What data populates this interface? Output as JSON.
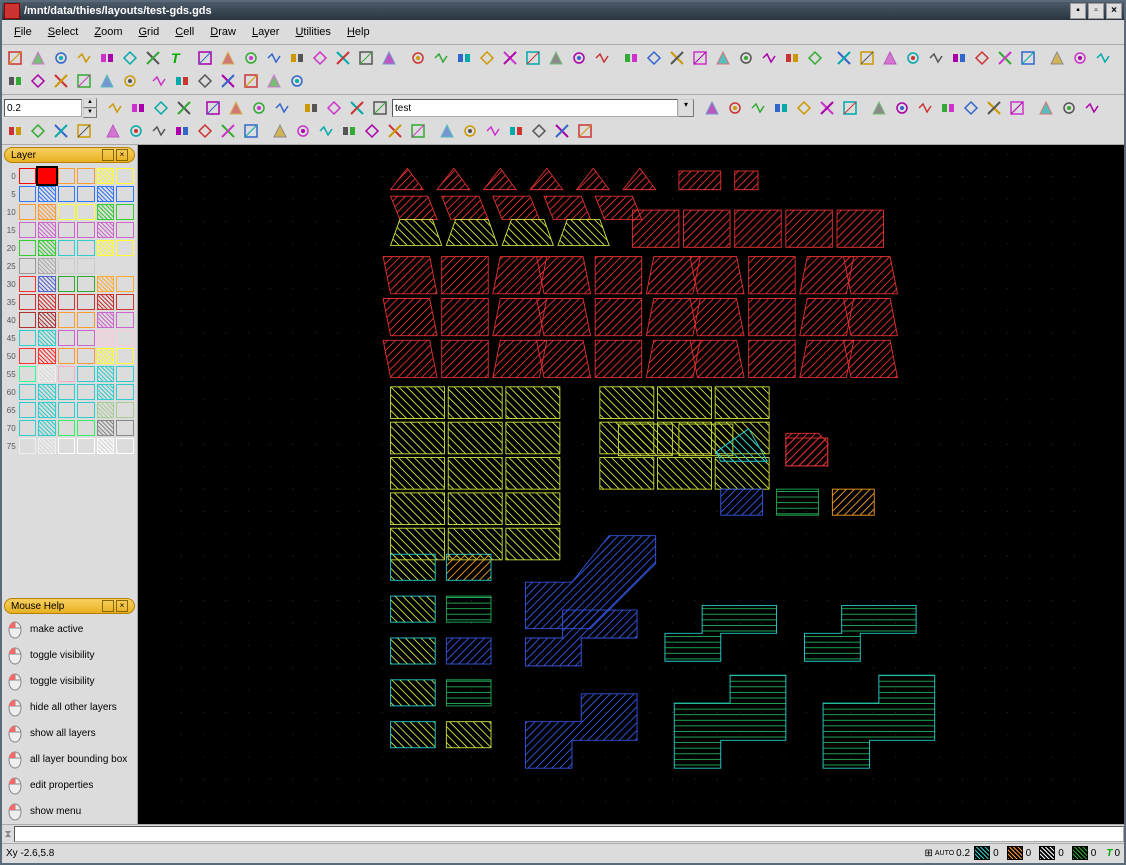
{
  "title": "/mnt/data/thies/layouts/test-gds.gds",
  "menus": [
    "File",
    "Select",
    "Zoom",
    "Grid",
    "Cell",
    "Draw",
    "Layer",
    "Utilities",
    "Help"
  ],
  "spin_value": "0.2",
  "cell_name": "test",
  "panel_layer_title": "Layer",
  "panel_mouse_title": "Mouse Help",
  "layer_rows": [
    {
      "n": "0",
      "c": [
        "#ff0000",
        "#ff0000",
        "#ff9933",
        "#ff9933",
        "#ffff33",
        "#ffff33"
      ]
    },
    {
      "n": "5",
      "c": [
        "#3377ff",
        "#3377ff",
        "#3377ff",
        "#3377ff",
        "#3377ff",
        "#3377ff"
      ]
    },
    {
      "n": "10",
      "c": [
        "#ff9933",
        "#ff9933",
        "#ffff33",
        "#ffff33",
        "#33cc33",
        "#33cc33"
      ]
    },
    {
      "n": "15",
      "c": [
        "#cc66cc",
        "#cc66cc",
        "#cc66cc",
        "#cc66cc",
        "#cc66cc",
        "#cc66cc"
      ]
    },
    {
      "n": "20",
      "c": [
        "#33cc33",
        "#33cc33",
        "#33cccc",
        "#33cccc",
        "#ffff33",
        "#ffff33"
      ]
    },
    {
      "n": "25",
      "c": [
        "#999999",
        "#aaaaaa",
        "#cccccc",
        "#cccccc",
        "#dddddd",
        "#dddddd"
      ]
    },
    {
      "n": "30",
      "c": [
        "#ff3333",
        "#5566cc",
        "#33aa33",
        "#33aa33",
        "#ffaa33",
        "#ffaa33"
      ]
    },
    {
      "n": "35",
      "c": [
        "#cc3333",
        "#cc3333",
        "#cc3333",
        "#cc3333",
        "#cc3333",
        "#cc3333"
      ]
    },
    {
      "n": "40",
      "c": [
        "#aa3333",
        "#aa3333",
        "#ff9933",
        "#ff9933",
        "#cc66cc",
        "#cc66cc"
      ]
    },
    {
      "n": "45",
      "c": [
        "#33cccc",
        "#33cccc",
        "#cc66cc",
        "#cc66cc",
        "#ffccdd",
        "#ffccdd"
      ]
    },
    {
      "n": "50",
      "c": [
        "#ff3333",
        "#ff3333",
        "#ff9933",
        "#ff9933",
        "#ffff33",
        "#ffff33"
      ]
    },
    {
      "n": "55",
      "c": [
        "#33ff99",
        "#eeeeee",
        "#ffaacc",
        "#33cccc",
        "#33cccc",
        "#33cccc"
      ]
    },
    {
      "n": "60",
      "c": [
        "#33cccc",
        "#33cccc",
        "#33cccc",
        "#33cccc",
        "#33cccc",
        "#33cccc"
      ]
    },
    {
      "n": "65",
      "c": [
        "#33cccc",
        "#33cccc",
        "#33cccc",
        "#33cccc",
        "#aacc99",
        "#aacc99"
      ]
    },
    {
      "n": "70",
      "c": [
        "#33cccc",
        "#33cccc",
        "#33ee66",
        "#33ee66",
        "#888888",
        "#888888"
      ]
    },
    {
      "n": "75",
      "c": [
        "#eeeeee",
        "#eeeeee",
        "#ffffff",
        "#ffffff",
        "#ffffff",
        "#ffffff"
      ]
    }
  ],
  "mouse_help": [
    "make active",
    "toggle visibility",
    "toggle visibility",
    "hide all other layers",
    "show all layers",
    "all layer bounding box",
    "edit properties",
    "show menu"
  ],
  "status_xy_label": "Xy",
  "status_xy": "-2.6,5.8",
  "status_grid_label": "0.2",
  "status_chips": [
    {
      "color": "#33cccc",
      "val": "0"
    },
    {
      "color": "#ff9933",
      "val": "0"
    },
    {
      "color": "#ffffff",
      "val": "0"
    },
    {
      "color": "#33aa33",
      "val": "0"
    }
  ],
  "status_T": "0",
  "toolbar_icons_row1": 60,
  "toolbar_icons_row2": 42
}
